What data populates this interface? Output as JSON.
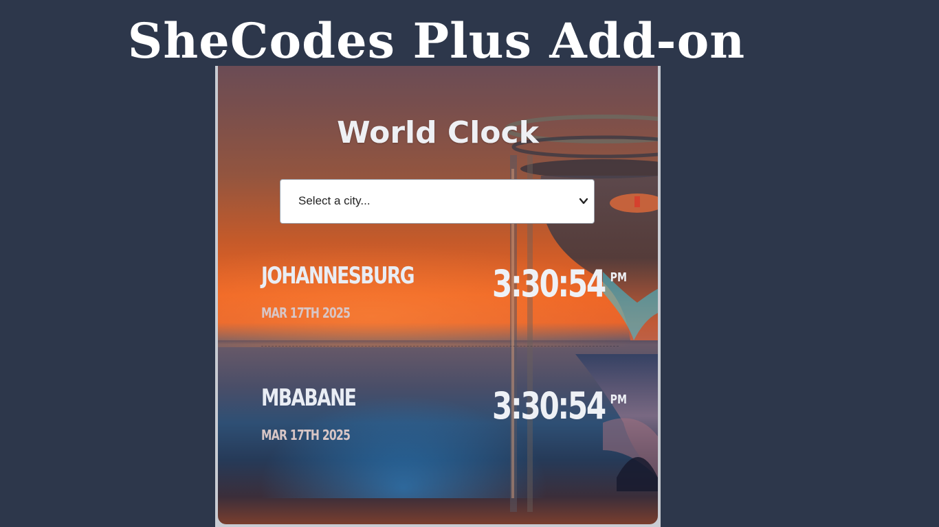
{
  "banner": {
    "title": "SheCodes Plus Add-on"
  },
  "app": {
    "title": "World Clock"
  },
  "city_select": {
    "selected": "Select a city..."
  },
  "cities": [
    {
      "name": "JOHANNESBURG",
      "date": "MAR 17TH 2025",
      "time": "3:30:54",
      "ampm": "PM"
    },
    {
      "name": "MBABANE",
      "date": "MAR 17TH 2025",
      "time": "3:30:54",
      "ampm": "PM"
    }
  ],
  "colors": {
    "background": "#2d374b",
    "text": "#eef0f4",
    "accent_orange": "#ee6424",
    "accent_blue": "#2e4f74"
  }
}
